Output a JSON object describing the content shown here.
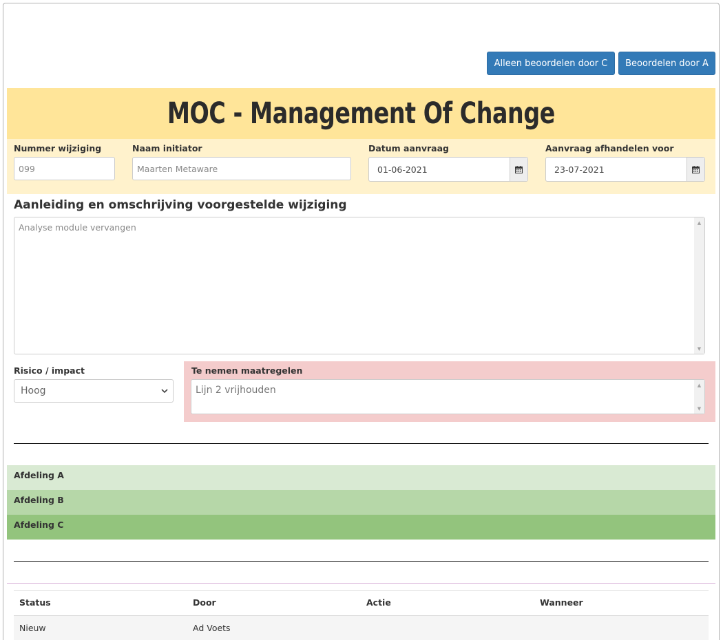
{
  "toolbar": {
    "review_c_label": "Alleen beoordelen door C",
    "review_a_label": "Beoordelen door A"
  },
  "title": "MOC - Management Of Change",
  "form": {
    "number_label": "Nummer wijziging",
    "number_placeholder": "099",
    "initiator_label": "Naam initiator",
    "initiator_placeholder": "Maarten Metaware",
    "request_date_label": "Datum aanvraag",
    "request_date_value": "01-06-2021",
    "handle_before_label": "Aanvraag afhandelen voor",
    "handle_before_value": "23-07-2021"
  },
  "description": {
    "title": "Aanleiding en omschrijving voorgestelde wijziging",
    "placeholder": "Analyse module vervangen"
  },
  "risk": {
    "label": "Risico / impact",
    "selected": "Hoog"
  },
  "measures": {
    "label": "Te nemen maatregelen",
    "placeholder": "Lijn 2 vrijhouden"
  },
  "departments": [
    {
      "label": "Afdeling A",
      "color": "#d9ead3"
    },
    {
      "label": "Afdeling B",
      "color": "#b6d7a8"
    },
    {
      "label": "Afdeling C",
      "color": "#93c47d"
    }
  ],
  "history": {
    "headers": [
      "Status",
      "Door",
      "Actie",
      "Wanneer"
    ],
    "rows": [
      [
        "Nieuw",
        "Ad Voets",
        "",
        ""
      ]
    ]
  },
  "colors": {
    "primary": "#337ab7",
    "title_bg": "#ffe599",
    "info_bg": "#fff2cc",
    "measures_bg": "#f4cccc"
  }
}
